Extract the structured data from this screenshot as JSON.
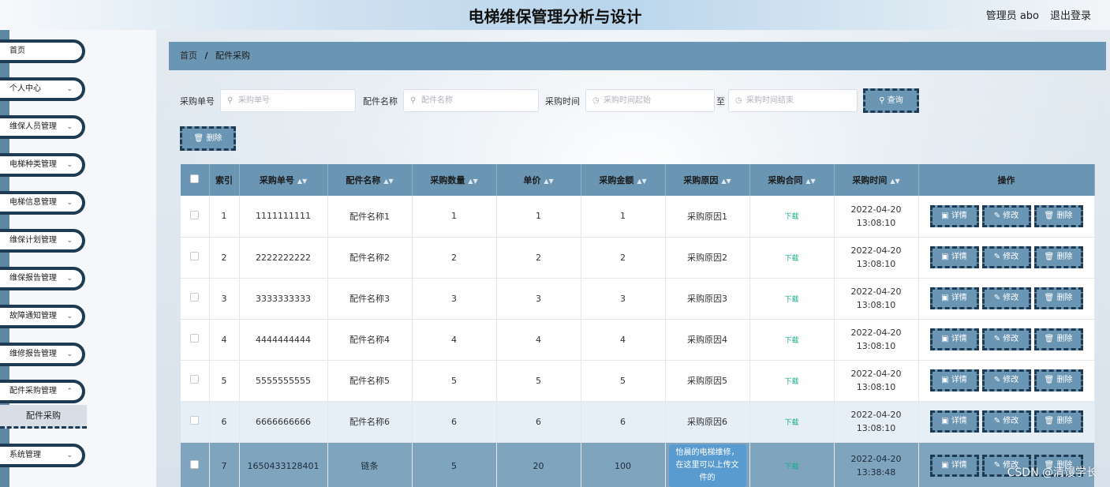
{
  "header": {
    "title": "电梯维保管理分析与设计",
    "user": "管理员 abo",
    "logout": "退出登录"
  },
  "sidebar": {
    "items": [
      {
        "label": "首页",
        "has_chevron": false
      },
      {
        "label": "个人中心",
        "has_chevron": true
      },
      {
        "label": "维保人员管理",
        "has_chevron": true
      },
      {
        "label": "电梯种类管理",
        "has_chevron": true
      },
      {
        "label": "电梯信息管理",
        "has_chevron": true
      },
      {
        "label": "维保计划管理",
        "has_chevron": true
      },
      {
        "label": "维保报告管理",
        "has_chevron": true
      },
      {
        "label": "故障通知管理",
        "has_chevron": true
      },
      {
        "label": "维修报告管理",
        "has_chevron": true
      },
      {
        "label": "配件采购管理",
        "has_chevron": true
      },
      {
        "label": "系统管理",
        "has_chevron": true
      }
    ],
    "submenu": {
      "label": "配件采购"
    }
  },
  "breadcrumb": {
    "home": "首页",
    "separator": "/",
    "current": "配件采购"
  },
  "search": {
    "order_label": "采购单号",
    "order_placeholder": "采购单号",
    "part_label": "配件名称",
    "part_placeholder": "配件名称",
    "time_label": "采购时间",
    "time_start_placeholder": "采购时间起始",
    "time_to": "至",
    "time_end_placeholder": "采购时间结束",
    "query_button": "查询"
  },
  "toolbar": {
    "delete_button": "删除"
  },
  "table": {
    "columns": [
      "索引",
      "采购单号",
      "配件名称",
      "采购数量",
      "单价",
      "采购金额",
      "采购原因",
      "采购合同",
      "采购时间",
      "操作"
    ],
    "rows": [
      {
        "index": "1",
        "order": "1111111111",
        "part": "配件名称1",
        "qty": "1",
        "price": "1",
        "amount": "1",
        "reason": "采购原因1",
        "contract": "下载",
        "time": "2022-04-20 13:08:10"
      },
      {
        "index": "2",
        "order": "2222222222",
        "part": "配件名称2",
        "qty": "2",
        "price": "2",
        "amount": "2",
        "reason": "采购原因2",
        "contract": "下载",
        "time": "2022-04-20 13:08:10"
      },
      {
        "index": "3",
        "order": "3333333333",
        "part": "配件名称3",
        "qty": "3",
        "price": "3",
        "amount": "3",
        "reason": "采购原因3",
        "contract": "下载",
        "time": "2022-04-20 13:08:10"
      },
      {
        "index": "4",
        "order": "4444444444",
        "part": "配件名称4",
        "qty": "4",
        "price": "4",
        "amount": "4",
        "reason": "采购原因4",
        "contract": "下载",
        "time": "2022-04-20 13:08:10"
      },
      {
        "index": "5",
        "order": "5555555555",
        "part": "配件名称5",
        "qty": "5",
        "price": "5",
        "amount": "5",
        "reason": "采购原因5",
        "contract": "下载",
        "time": "2022-04-20 13:08:10"
      },
      {
        "index": "6",
        "order": "6666666666",
        "part": "配件名称6",
        "qty": "6",
        "price": "6",
        "amount": "6",
        "reason": "采购原因6",
        "contract": "下载",
        "time": "2022-04-20 13:08:10"
      },
      {
        "index": "7",
        "order": "1650433128401",
        "part": "链条",
        "qty": "5",
        "price": "20",
        "amount": "100",
        "reason": "怡晨的电梯维修，在这里可以上传文件的",
        "contract": "下载",
        "time": "2022-04-20 13:38:48"
      }
    ],
    "actions": {
      "detail": "详情",
      "edit": "修改",
      "delete": "删除"
    }
  },
  "watermark": "CSDN @清馒学长",
  "colors": {
    "accent": "#6b96b3",
    "border_dark": "#1f3b53",
    "download": "#19a98a"
  }
}
